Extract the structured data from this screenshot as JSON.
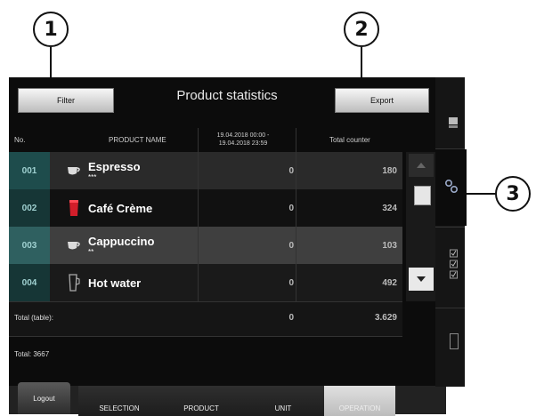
{
  "callouts": [
    "1",
    "2",
    "3"
  ],
  "header": {
    "filter_label": "Filter",
    "title": "Product statistics",
    "export_label": "Export"
  },
  "table": {
    "columns": {
      "no": "No.",
      "product_name": "PRODUCT NAME",
      "date_range_line1": "19.04.2018 00:00 -",
      "date_range_line2": "19.04.2018 23:59",
      "total_counter": "Total counter"
    },
    "rows": [
      {
        "no": "001",
        "name": "Espresso",
        "strength": "***",
        "period": "0",
        "total": "180",
        "icon": "espresso-cup-icon"
      },
      {
        "no": "002",
        "name": "Café Crème",
        "strength": "",
        "period": "0",
        "total": "324",
        "icon": "red-mug-icon"
      },
      {
        "no": "003",
        "name": "Cappuccino",
        "strength": "**",
        "period": "0",
        "total": "103",
        "icon": "cappuccino-cup-icon"
      },
      {
        "no": "004",
        "name": "Hot water",
        "strength": "",
        "period": "0",
        "total": "492",
        "icon": "hot-water-glass-icon"
      }
    ],
    "total_table_label": "Total (table):",
    "total_table_period": "0",
    "total_table_counter": "3.629",
    "total_all_label": "Total: 3667"
  },
  "bottom_nav": {
    "logout": "Logout",
    "selection": "SELECTION",
    "product": "PRODUCT",
    "unit": "UNIT",
    "operation": "OPERATION"
  },
  "colors": {
    "row_dark": "#2a2a2a",
    "row_light": "#3f3f3f",
    "no_cell_dark": "#1e4c4c",
    "no_cell_light": "#2f6060",
    "operation_active": "#d8d8d8"
  }
}
